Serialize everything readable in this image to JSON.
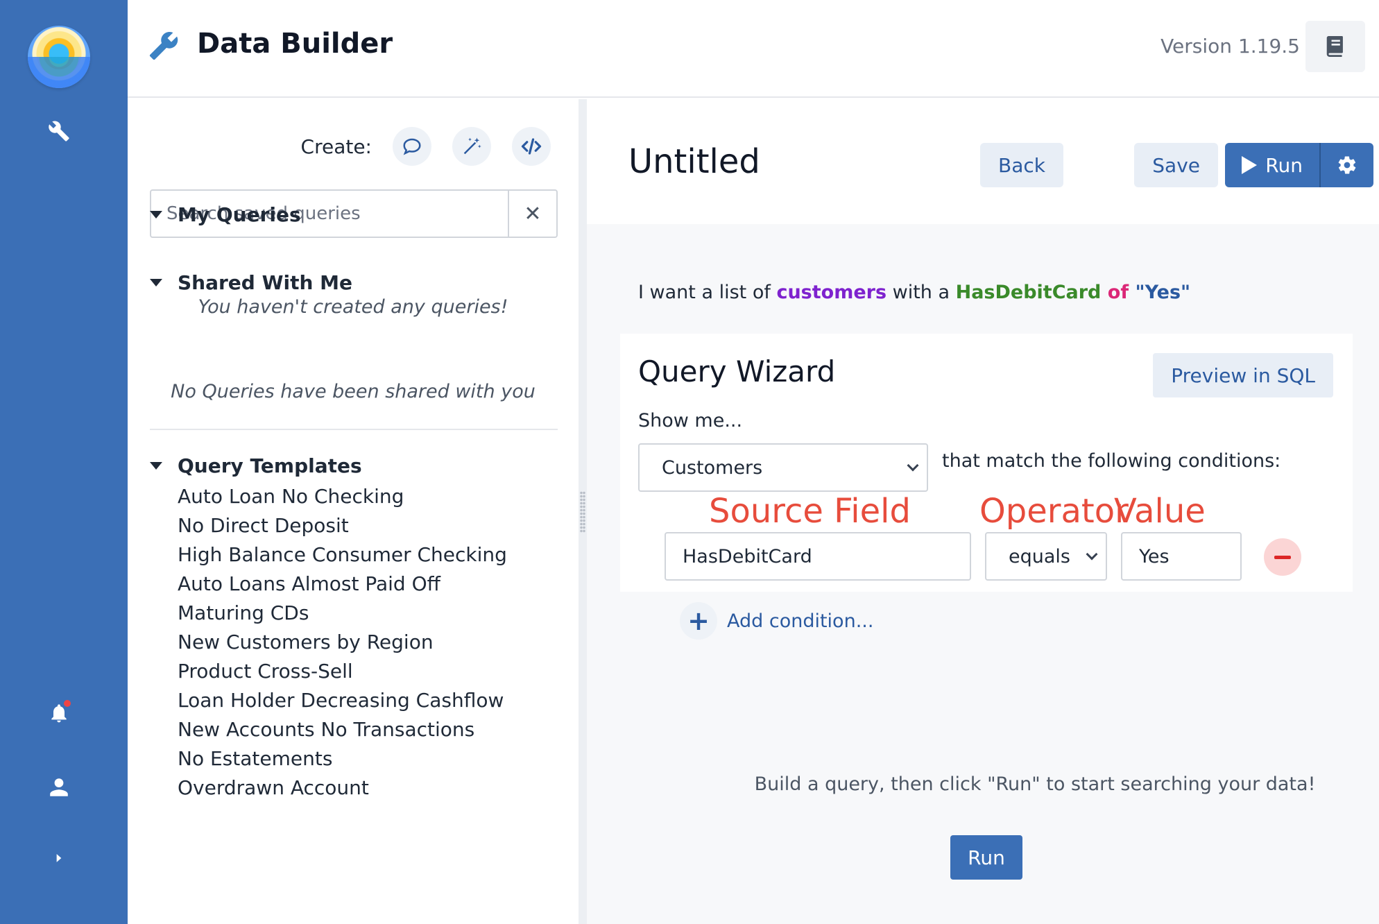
{
  "header": {
    "title": "Data Builder",
    "version": "Version 1.19.5"
  },
  "rail": {
    "icons": [
      "logo",
      "wrench-icon",
      "bell-icon",
      "user-icon",
      "chevron-right-icon"
    ]
  },
  "left": {
    "create_label": "Create:",
    "search_placeholder": "Search saved queries",
    "my_queries": {
      "title": "My Queries",
      "empty": "You haven't created any queries!"
    },
    "shared": {
      "title": "Shared With Me",
      "empty": "No Queries have been shared with you"
    },
    "templates": {
      "title": "Query Templates",
      "items": [
        "Auto Loan No Checking",
        "No Direct Deposit",
        "High Balance Consumer Checking",
        "Auto Loans Almost Paid Off",
        "Maturing CDs",
        "New Customers by Region",
        "Product Cross-Sell",
        "Loan Holder Decreasing Cashflow",
        "New Accounts No Transactions",
        "No Estatements",
        "Overdrawn Account"
      ]
    }
  },
  "main": {
    "title": "Untitled",
    "back_label": "Back",
    "save_label": "Save",
    "run_label": "Run",
    "sentence": {
      "prefix": "I want a list of ",
      "entity": "customers",
      "mid": " with a ",
      "field": "HasDebitCard",
      "of": " of ",
      "value": "\"Yes\""
    },
    "wizard": {
      "title": "Query Wizard",
      "preview_label": "Preview in SQL",
      "show_me": "Show me...",
      "entity_select": "Customers",
      "match_text": "that match the following conditions:",
      "labels": {
        "source": "Source Field",
        "operator": "Operator",
        "value": "Value"
      },
      "condition": {
        "field": "HasDebitCard",
        "operator": "equals",
        "value": "Yes"
      },
      "add_condition": "Add condition..."
    },
    "hint": "Build a query, then click \"Run\" to start searching your data!",
    "run_bottom_label": "Run"
  },
  "colors": {
    "rail": "#3b6fb6",
    "accent": "#2b5aa0",
    "annotation": "#e74c3c"
  }
}
